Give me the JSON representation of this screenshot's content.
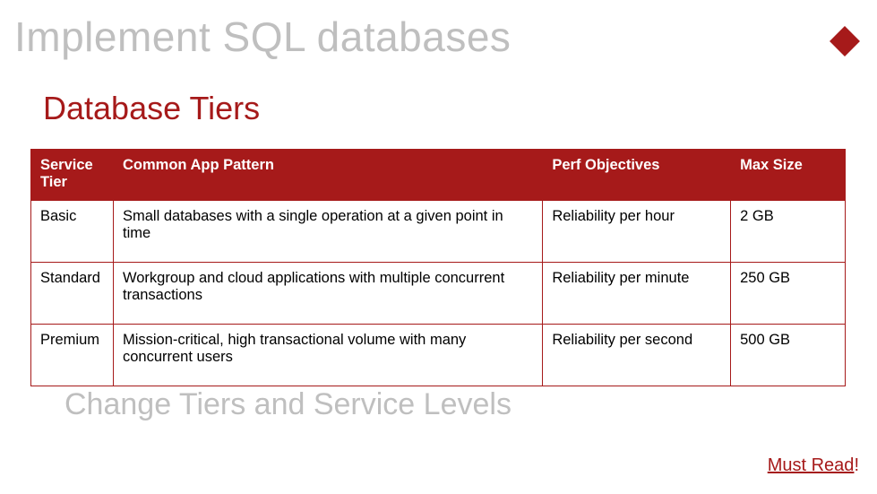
{
  "slideTitle": "Implement SQL databases",
  "subtitle": "Database Tiers",
  "sectionHeading": "Change Tiers and Service Levels",
  "mustRead": {
    "label": "Must Read",
    "bang": "!"
  },
  "table": {
    "headers": {
      "tier": "Service Tier",
      "pattern": "Common App Pattern",
      "perf": "Perf Objectives",
      "size": "Max Size"
    },
    "rows": [
      {
        "tier": "Basic",
        "pattern": "Small databases with a single operation at a given point in time",
        "perf": "Reliability per hour",
        "size": "2 GB"
      },
      {
        "tier": "Standard",
        "pattern": "Workgroup and cloud applications with multiple concurrent transactions",
        "perf": "Reliability per minute",
        "size": "250 GB"
      },
      {
        "tier": "Premium",
        "pattern": "Mission-critical, high transactional volume with many concurrent users",
        "perf": "Reliability per second",
        "size": "500 GB"
      }
    ]
  }
}
